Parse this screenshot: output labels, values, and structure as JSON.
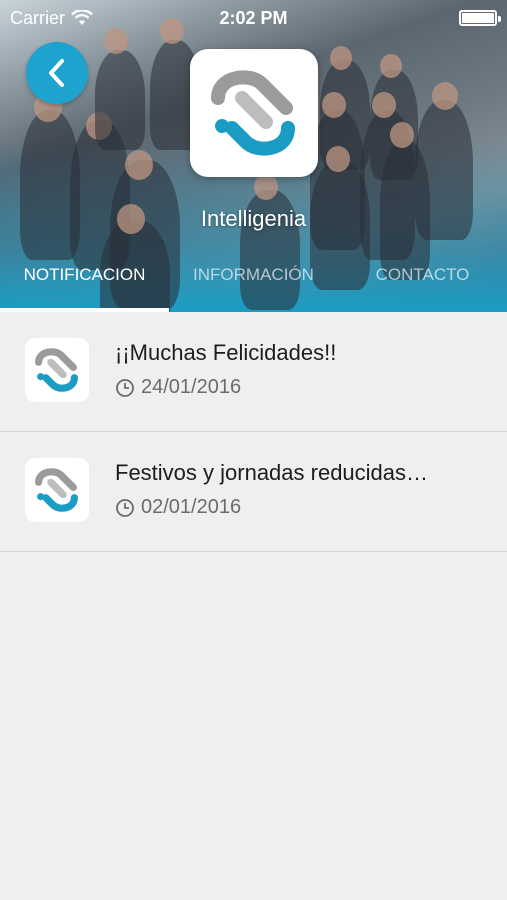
{
  "status_bar": {
    "carrier": "Carrier",
    "time": "2:02 PM"
  },
  "header": {
    "company_name": "Intelligenia"
  },
  "tabs": [
    {
      "label": "NOTIFICACION",
      "active": true
    },
    {
      "label": "INFORMACIÓN",
      "active": false
    },
    {
      "label": "CONTACTO",
      "active": false
    }
  ],
  "notifications": [
    {
      "title": "¡¡Muchas Felicidades!!",
      "date": "24/01/2016"
    },
    {
      "title": "Festivos y jornadas reducidas…",
      "date": "02/01/2016"
    }
  ],
  "colors": {
    "accent": "#1ea3cf",
    "logo_gray": "#9b9b9b",
    "logo_blue": "#1a9cc4"
  },
  "icons": {
    "back": "chevron-left-icon",
    "clock": "clock-icon",
    "wifi": "wifi-icon",
    "battery": "battery-icon",
    "logo": "intelligenia-logo"
  }
}
